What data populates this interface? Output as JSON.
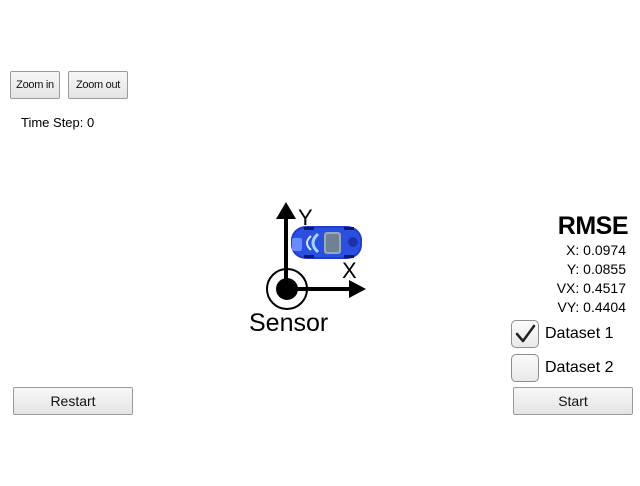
{
  "toolbar": {
    "zoom_in_label": "Zoom in",
    "zoom_out_label": "Zoom out"
  },
  "status": {
    "time_step": "Time Step: 0"
  },
  "scene": {
    "sensor_label": "Sensor",
    "axis_x_label": "X",
    "axis_y_label": "Y",
    "car_color": "#1f3ec9"
  },
  "rmse": {
    "title": "RMSE",
    "x": "X: 0.0974",
    "y": "Y: 0.0855",
    "vx": "VX: 0.4517",
    "vy": "VY: 0.4404"
  },
  "datasets": [
    {
      "label": "Dataset 1",
      "checked": true
    },
    {
      "label": "Dataset 2",
      "checked": false
    }
  ],
  "controls": {
    "restart_label": "Restart",
    "start_label": "Start"
  }
}
